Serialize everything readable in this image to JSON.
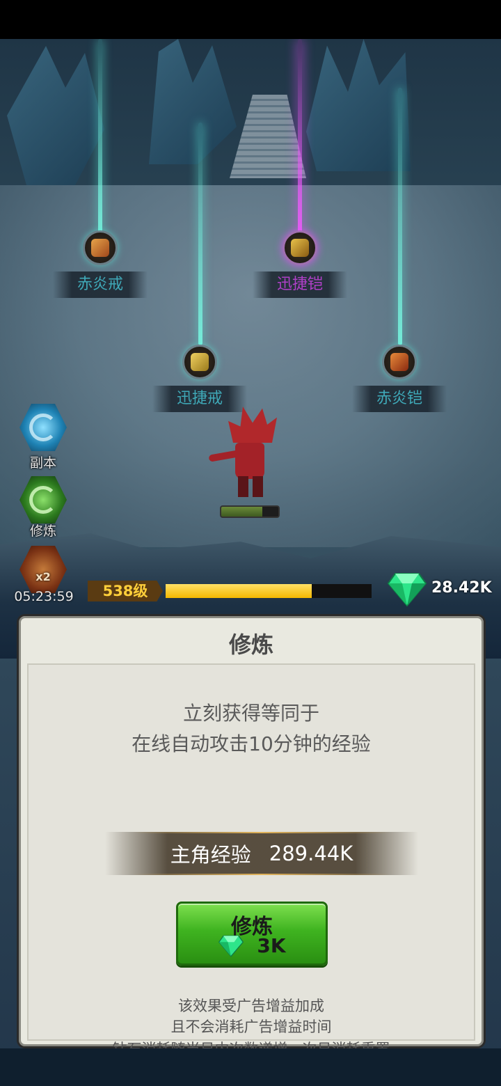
{
  "scene": {
    "items": [
      {
        "name": "赤炎戒",
        "glow": "teal"
      },
      {
        "name": "迅捷铠",
        "glow": "purple"
      },
      {
        "name": "迅捷戒",
        "glow": "teal"
      },
      {
        "name": "赤炎铠",
        "glow": "teal"
      }
    ],
    "hero_hp_fraction": 0.72
  },
  "sidebar": {
    "dungeon_label": "副本",
    "train_label": "修炼",
    "boost_badge": "x2",
    "boost_timer": "05:23:59"
  },
  "hud": {
    "level": "538级",
    "xp_fraction": 0.71,
    "diamonds": "28.42K"
  },
  "panel": {
    "title": "修炼",
    "desc_line1": "立刻获得等同于",
    "desc_line2": "在线自动攻击10分钟的经验",
    "exp_label": "主角经验",
    "exp_value": "289.44K",
    "button_label": "修炼",
    "button_cost": "3K",
    "note1": "该效果受广告增益加成",
    "note2": "且不会消耗广告增益时间",
    "note3": "钻石消耗随当日内次数递增，次日消耗重置"
  },
  "colors": {
    "gem": "#2ee58a",
    "button": "#3fb320",
    "xp": "#f3b800"
  }
}
